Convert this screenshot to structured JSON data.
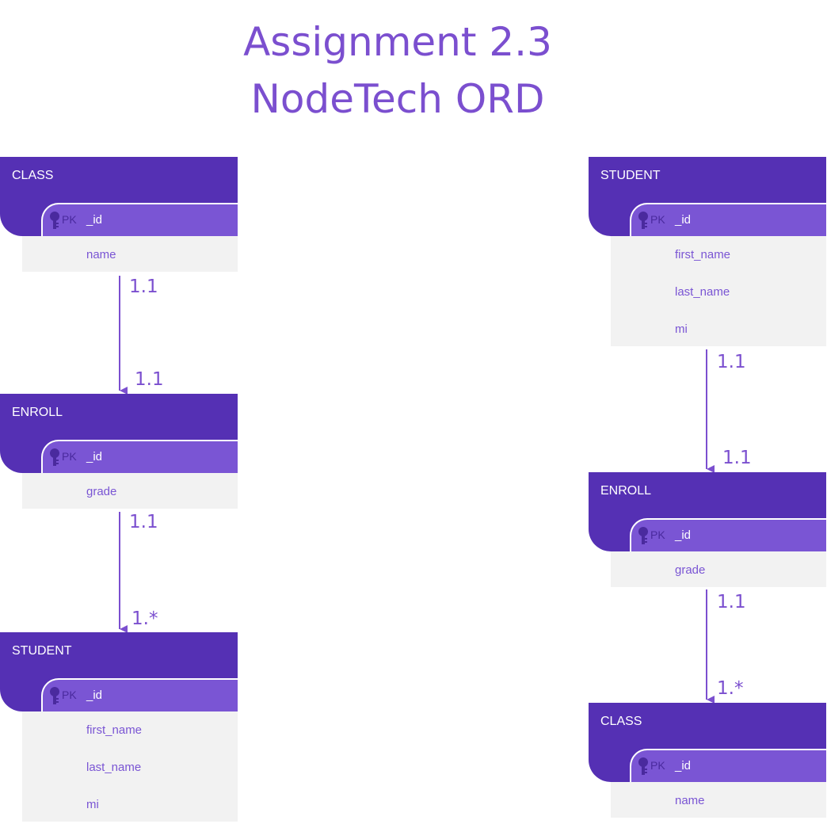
{
  "title": {
    "line1": "Assignment 2.3",
    "line2": "NodeTech ORD"
  },
  "pk_label": "PK",
  "colors": {
    "header": "#5530b4",
    "pk_row": "#7a55d4",
    "attr_bg": "#f2f2f2",
    "text_accent": "#7b4fcf"
  },
  "left_chain": {
    "entities": [
      {
        "name": "CLASS",
        "pk": "_id",
        "attributes": [
          "name"
        ]
      },
      {
        "name": "ENROLL",
        "pk": "_id",
        "attributes": [
          "grade"
        ]
      },
      {
        "name": "STUDENT",
        "pk": "_id",
        "attributes": [
          "first_name",
          "last_name",
          "mi"
        ]
      }
    ],
    "relationships": [
      {
        "from": "CLASS",
        "to": "ENROLL",
        "from_card": "1.1",
        "to_card": "1.1"
      },
      {
        "from": "ENROLL",
        "to": "STUDENT",
        "from_card": "1.1",
        "to_card": "1.*"
      }
    ]
  },
  "right_chain": {
    "entities": [
      {
        "name": "STUDENT",
        "pk": "_id",
        "attributes": [
          "first_name",
          "last_name",
          "mi"
        ]
      },
      {
        "name": "ENROLL",
        "pk": "_id",
        "attributes": [
          "grade"
        ]
      },
      {
        "name": "CLASS",
        "pk": "_id",
        "attributes": [
          "name"
        ]
      }
    ],
    "relationships": [
      {
        "from": "STUDENT",
        "to": "ENROLL",
        "from_card": "1.1",
        "to_card": "1.1"
      },
      {
        "from": "ENROLL",
        "to": "CLASS",
        "from_card": "1.1",
        "to_card": "1.*"
      }
    ]
  }
}
